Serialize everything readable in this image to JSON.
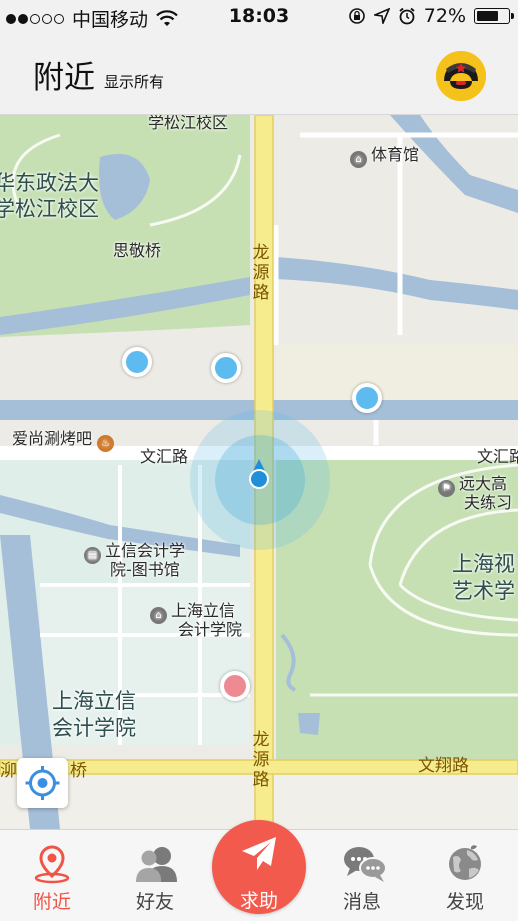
{
  "status_bar": {
    "carrier": "中国移动",
    "time": "18:03",
    "battery": "72%",
    "battery_level": 0.72
  },
  "header": {
    "title": "附近",
    "subtitle": "显示所有"
  },
  "map": {
    "labels": {
      "school_top": "学松江校区",
      "gym": "体育馆",
      "ecupl_line1": "华东政法大",
      "ecupl_line2": "学松江校区",
      "siqiao": "思敬桥",
      "longyuan": "龙源路",
      "bbq": "爱尚涮烤吧",
      "wenhui_left": "文汇路",
      "wenhui_right": "文汇路",
      "yuanda_line1": "远大高",
      "yuanda_line2": "夫练习",
      "library_line1": "立信会计学",
      "library_line2": "院-图书馆",
      "lixin_small_line1": "上海立信",
      "lixin_small_line2": "会计学院",
      "visual_line1": "上海视",
      "visual_line2": "艺术学",
      "lixin_big_line1": "上海立信",
      "lixin_big_line2": "会计学院",
      "bridge": "桥",
      "wenxiang": "文翔路"
    }
  },
  "tabs": [
    {
      "label": "附近",
      "icon": "map-pin-icon",
      "active": true
    },
    {
      "label": "好友",
      "icon": "friends-icon",
      "active": false
    },
    {
      "label": "求助",
      "icon": "paper-plane-icon",
      "active": false
    },
    {
      "label": "消息",
      "icon": "chat-icon",
      "active": false
    },
    {
      "label": "发现",
      "icon": "globe-icon",
      "active": false
    }
  ],
  "colors": {
    "accent": "#f05447",
    "sos": "#f15a4d",
    "user_dot": "#5dbbf0",
    "water": "#a5bfd9",
    "road_major": "#f7ec8d",
    "green": "#c6e0b4"
  }
}
